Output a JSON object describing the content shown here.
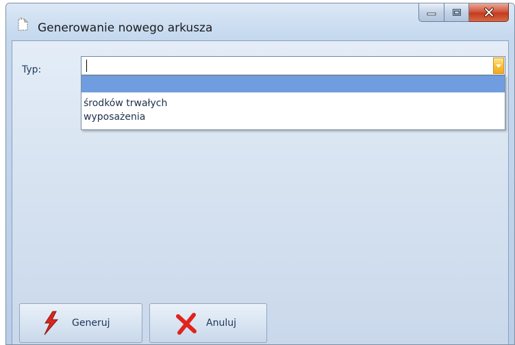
{
  "window": {
    "title": "Generowanie nowego arkusza",
    "icon": "sheet-wizard-icon"
  },
  "form": {
    "typ_label": "Typ:",
    "typ_value": ""
  },
  "dropdown": {
    "options": [
      "",
      "środków trwałych",
      "wyposażenia"
    ],
    "selected_index": 0
  },
  "buttons": {
    "generuj": "Generuj",
    "anuluj": "Anuluj"
  },
  "colors": {
    "selection": "#6f9de0",
    "close_button": "#c43b1d",
    "combo_button": "#f9c13c",
    "generuj_icon": "#d6281e",
    "anuluj_icon": "#e0241c"
  }
}
